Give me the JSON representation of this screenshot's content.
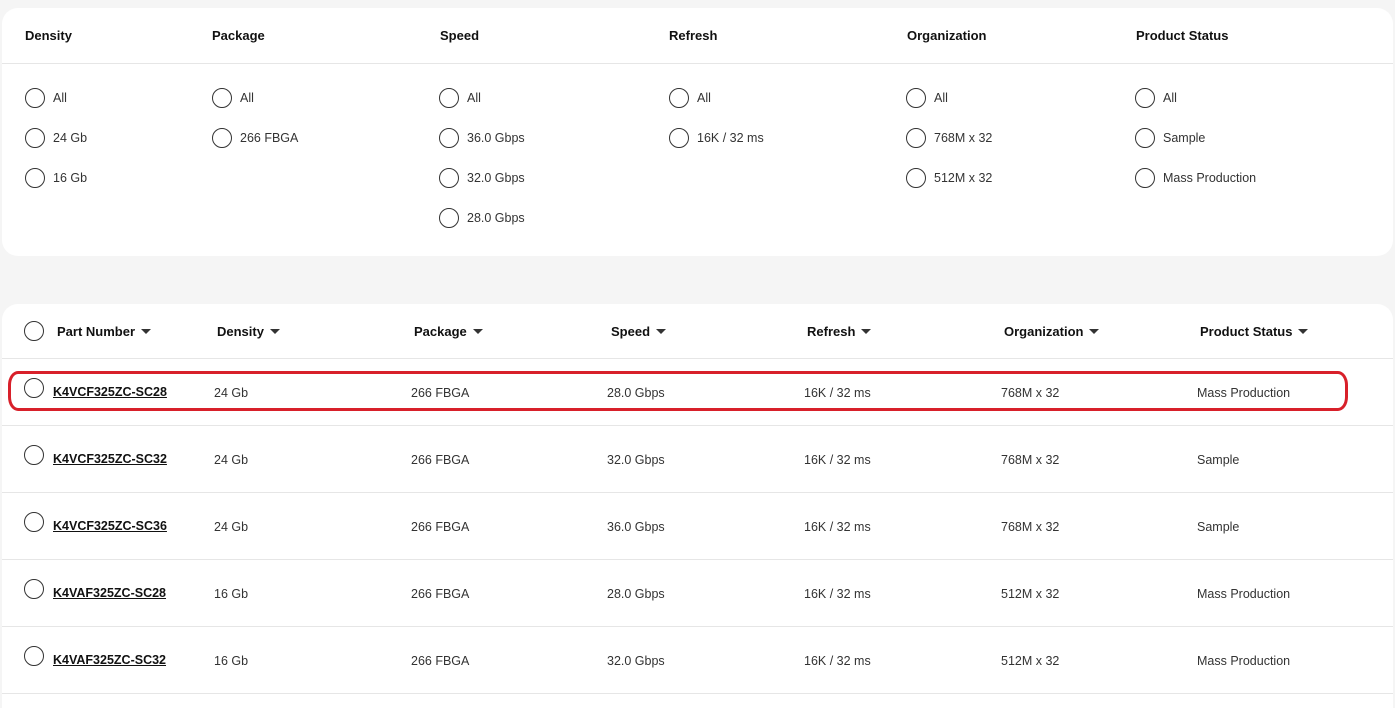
{
  "filters": {
    "headers": [
      "Density",
      "Package",
      "Speed",
      "Refresh",
      "Organization",
      "Product Status"
    ],
    "density": [
      "All",
      "24 Gb",
      "16 Gb"
    ],
    "package": [
      "All",
      "266 FBGA"
    ],
    "speed": [
      "All",
      "36.0 Gbps",
      "32.0 Gbps",
      "28.0 Gbps"
    ],
    "refresh": [
      "All",
      "16K / 32 ms"
    ],
    "organization": [
      "All",
      "768M x 32",
      "512M x 32"
    ],
    "status": [
      "All",
      "Sample",
      "Mass Production"
    ]
  },
  "table": {
    "headers": [
      "Part Number",
      "Density",
      "Package",
      "Speed",
      "Refresh",
      "Organization",
      "Product Status"
    ],
    "rows": [
      [
        "K4VCF325ZC-SC28",
        "24 Gb",
        "266 FBGA",
        "28.0 Gbps",
        "16K / 32 ms",
        "768M x 32",
        "Mass Production"
      ],
      [
        "K4VCF325ZC-SC32",
        "24 Gb",
        "266 FBGA",
        "32.0 Gbps",
        "16K / 32 ms",
        "768M x 32",
        "Sample"
      ],
      [
        "K4VCF325ZC-SC36",
        "24 Gb",
        "266 FBGA",
        "36.0 Gbps",
        "16K / 32 ms",
        "768M x 32",
        "Sample"
      ],
      [
        "K4VAF325ZC-SC28",
        "16 Gb",
        "266 FBGA",
        "28.0 Gbps",
        "16K / 32 ms",
        "512M x 32",
        "Mass Production"
      ],
      [
        "K4VAF325ZC-SC32",
        "16 Gb",
        "266 FBGA",
        "32.0 Gbps",
        "16K / 32 ms",
        "512M x 32",
        "Mass Production"
      ]
    ]
  },
  "colors": {
    "highlight": "#d8202a",
    "panel": "#ffffff",
    "background": "#f5f5f5"
  }
}
